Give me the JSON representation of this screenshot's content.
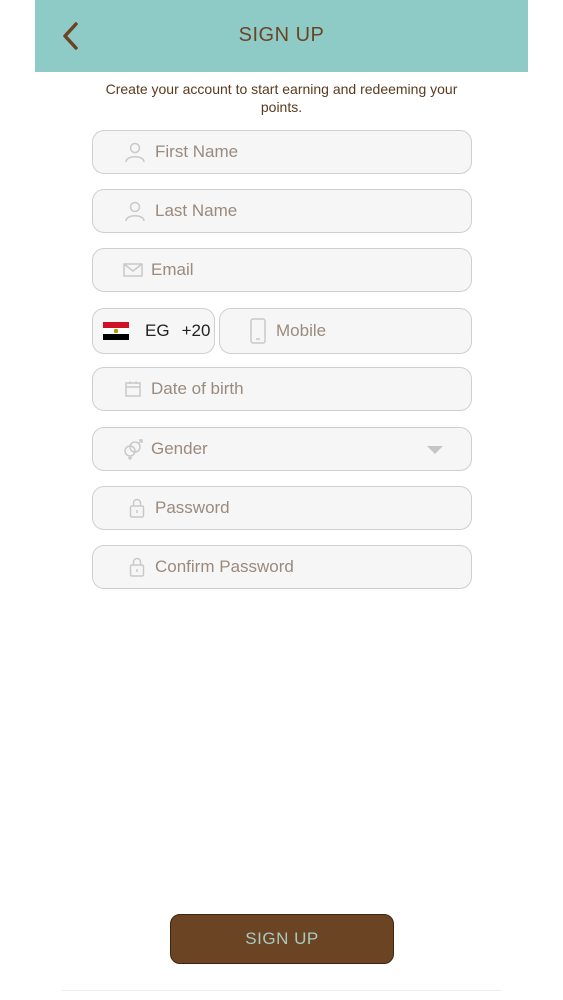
{
  "header": {
    "title": "SIGN UP"
  },
  "subtitle": "Create your account to start earning and redeeming your points.",
  "fields": {
    "first_name": "First Name",
    "last_name": "Last Name",
    "email": "Email",
    "mobile": "Mobile",
    "dob": "Date of birth",
    "gender": "Gender",
    "password": "Password",
    "confirm_password": "Confirm Password"
  },
  "country": {
    "code": "EG",
    "dial": "+20",
    "flag_colors": [
      "#ce1126",
      "#ffffff",
      "#000000"
    ]
  },
  "submit_label": "SIGN UP",
  "colors": {
    "header": "#8ecbc6",
    "accent": "#6b4424",
    "button_text": "#a9c9c0"
  },
  "icons": {
    "back": "chevron-left-icon",
    "person": "person-icon",
    "email": "envelope-icon",
    "mobile": "phone-icon",
    "calendar": "calendar-icon",
    "gender": "gender-icon",
    "lock": "lock-icon",
    "dropdown": "caret-down-icon"
  }
}
